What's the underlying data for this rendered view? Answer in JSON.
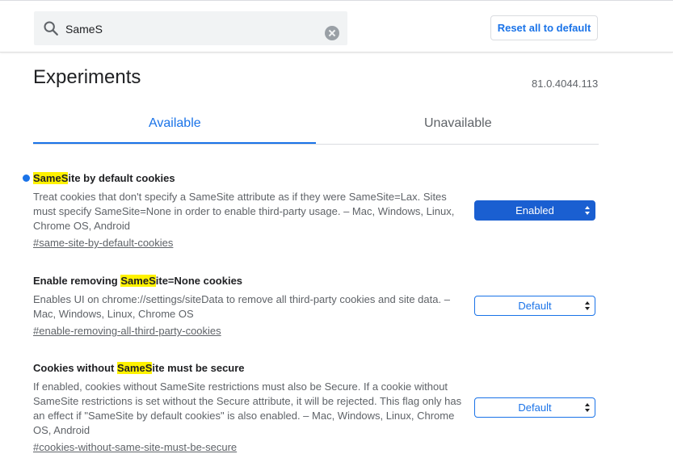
{
  "search": {
    "value": "SameS",
    "clear_icon": "clear-icon",
    "search_icon": "search-icon"
  },
  "header": {
    "reset_label": "Reset all to default"
  },
  "page": {
    "title": "Experiments",
    "version": "81.0.4044.113"
  },
  "tabs": [
    {
      "label": "Available",
      "selected": true
    },
    {
      "label": "Unavailable",
      "selected": false
    }
  ],
  "experiments": [
    {
      "title_pre": "",
      "title_mark": "SameS",
      "title_post": "ite by default cookies",
      "description": "Treat cookies that don't specify a SameSite attribute as if they were SameSite=Lax. Sites must specify SameSite=None in order to enable third-party usage. – Mac, Windows, Linux, Chrome OS, Android",
      "link": "#same-site-by-default-cookies",
      "select_value": "Enabled",
      "modified": true
    },
    {
      "title_pre": "Enable removing ",
      "title_mark": "SameS",
      "title_post": "ite=None cookies",
      "description": "Enables UI on chrome://settings/siteData to remove all third-party cookies and site data. – Mac, Windows, Linux, Chrome OS",
      "link": "#enable-removing-all-third-party-cookies",
      "select_value": "Default",
      "modified": false
    },
    {
      "title_pre": "Cookies without ",
      "title_mark": "SameS",
      "title_post": "ite must be secure",
      "description": "If enabled, cookies without SameSite restrictions must also be Secure. If a cookie without SameSite restrictions is set without the Secure attribute, it will be rejected. This flag only has an effect if \"SameSite by default cookies\" is also enabled. – Mac, Windows, Linux, Chrome OS, Android",
      "link": "#cookies-without-same-site-must-be-secure",
      "select_value": "Default",
      "modified": false
    }
  ],
  "colors": {
    "accent": "#1a73e8",
    "highlight": "#fff200",
    "enabled_bg": "#1a5fd1"
  }
}
